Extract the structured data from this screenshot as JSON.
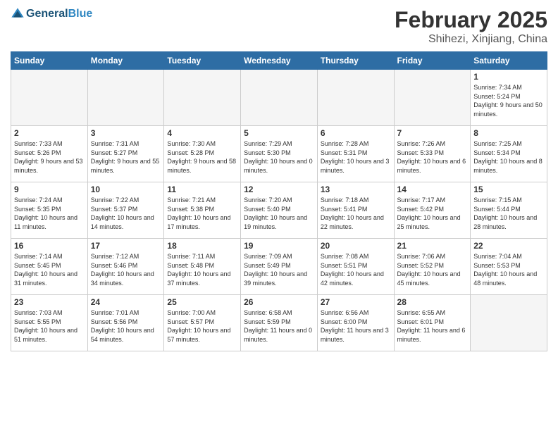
{
  "header": {
    "logo_line1": "General",
    "logo_line2": "Blue",
    "month": "February 2025",
    "location": "Shihezi, Xinjiang, China"
  },
  "weekdays": [
    "Sunday",
    "Monday",
    "Tuesday",
    "Wednesday",
    "Thursday",
    "Friday",
    "Saturday"
  ],
  "weeks": [
    [
      {
        "day": "",
        "info": ""
      },
      {
        "day": "",
        "info": ""
      },
      {
        "day": "",
        "info": ""
      },
      {
        "day": "",
        "info": ""
      },
      {
        "day": "",
        "info": ""
      },
      {
        "day": "",
        "info": ""
      },
      {
        "day": "1",
        "info": "Sunrise: 7:34 AM\nSunset: 5:24 PM\nDaylight: 9 hours\nand 50 minutes."
      }
    ],
    [
      {
        "day": "2",
        "info": "Sunrise: 7:33 AM\nSunset: 5:26 PM\nDaylight: 9 hours\nand 53 minutes."
      },
      {
        "day": "3",
        "info": "Sunrise: 7:31 AM\nSunset: 5:27 PM\nDaylight: 9 hours\nand 55 minutes."
      },
      {
        "day": "4",
        "info": "Sunrise: 7:30 AM\nSunset: 5:28 PM\nDaylight: 9 hours\nand 58 minutes."
      },
      {
        "day": "5",
        "info": "Sunrise: 7:29 AM\nSunset: 5:30 PM\nDaylight: 10 hours\nand 0 minutes."
      },
      {
        "day": "6",
        "info": "Sunrise: 7:28 AM\nSunset: 5:31 PM\nDaylight: 10 hours\nand 3 minutes."
      },
      {
        "day": "7",
        "info": "Sunrise: 7:26 AM\nSunset: 5:33 PM\nDaylight: 10 hours\nand 6 minutes."
      },
      {
        "day": "8",
        "info": "Sunrise: 7:25 AM\nSunset: 5:34 PM\nDaylight: 10 hours\nand 8 minutes."
      }
    ],
    [
      {
        "day": "9",
        "info": "Sunrise: 7:24 AM\nSunset: 5:35 PM\nDaylight: 10 hours\nand 11 minutes."
      },
      {
        "day": "10",
        "info": "Sunrise: 7:22 AM\nSunset: 5:37 PM\nDaylight: 10 hours\nand 14 minutes."
      },
      {
        "day": "11",
        "info": "Sunrise: 7:21 AM\nSunset: 5:38 PM\nDaylight: 10 hours\nand 17 minutes."
      },
      {
        "day": "12",
        "info": "Sunrise: 7:20 AM\nSunset: 5:40 PM\nDaylight: 10 hours\nand 19 minutes."
      },
      {
        "day": "13",
        "info": "Sunrise: 7:18 AM\nSunset: 5:41 PM\nDaylight: 10 hours\nand 22 minutes."
      },
      {
        "day": "14",
        "info": "Sunrise: 7:17 AM\nSunset: 5:42 PM\nDaylight: 10 hours\nand 25 minutes."
      },
      {
        "day": "15",
        "info": "Sunrise: 7:15 AM\nSunset: 5:44 PM\nDaylight: 10 hours\nand 28 minutes."
      }
    ],
    [
      {
        "day": "16",
        "info": "Sunrise: 7:14 AM\nSunset: 5:45 PM\nDaylight: 10 hours\nand 31 minutes."
      },
      {
        "day": "17",
        "info": "Sunrise: 7:12 AM\nSunset: 5:46 PM\nDaylight: 10 hours\nand 34 minutes."
      },
      {
        "day": "18",
        "info": "Sunrise: 7:11 AM\nSunset: 5:48 PM\nDaylight: 10 hours\nand 37 minutes."
      },
      {
        "day": "19",
        "info": "Sunrise: 7:09 AM\nSunset: 5:49 PM\nDaylight: 10 hours\nand 39 minutes."
      },
      {
        "day": "20",
        "info": "Sunrise: 7:08 AM\nSunset: 5:51 PM\nDaylight: 10 hours\nand 42 minutes."
      },
      {
        "day": "21",
        "info": "Sunrise: 7:06 AM\nSunset: 5:52 PM\nDaylight: 10 hours\nand 45 minutes."
      },
      {
        "day": "22",
        "info": "Sunrise: 7:04 AM\nSunset: 5:53 PM\nDaylight: 10 hours\nand 48 minutes."
      }
    ],
    [
      {
        "day": "23",
        "info": "Sunrise: 7:03 AM\nSunset: 5:55 PM\nDaylight: 10 hours\nand 51 minutes."
      },
      {
        "day": "24",
        "info": "Sunrise: 7:01 AM\nSunset: 5:56 PM\nDaylight: 10 hours\nand 54 minutes."
      },
      {
        "day": "25",
        "info": "Sunrise: 7:00 AM\nSunset: 5:57 PM\nDaylight: 10 hours\nand 57 minutes."
      },
      {
        "day": "26",
        "info": "Sunrise: 6:58 AM\nSunset: 5:59 PM\nDaylight: 11 hours\nand 0 minutes."
      },
      {
        "day": "27",
        "info": "Sunrise: 6:56 AM\nSunset: 6:00 PM\nDaylight: 11 hours\nand 3 minutes."
      },
      {
        "day": "28",
        "info": "Sunrise: 6:55 AM\nSunset: 6:01 PM\nDaylight: 11 hours\nand 6 minutes."
      },
      {
        "day": "",
        "info": ""
      }
    ]
  ]
}
